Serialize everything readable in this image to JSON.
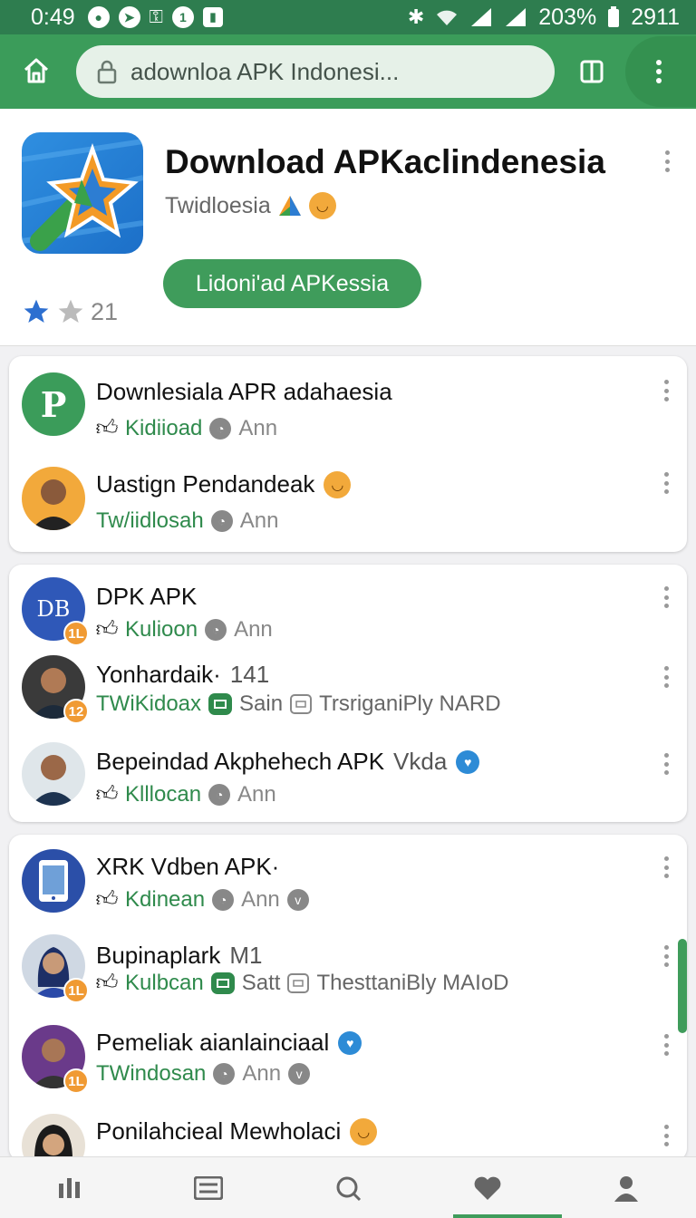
{
  "status_bar": {
    "time": "0:49",
    "battery": "203%",
    "clock_right": "2911"
  },
  "toolbar": {
    "url_text": "adownloa APK Indonesi..."
  },
  "app": {
    "title": "Download APKaclindenesia",
    "developer": "Twidloesia",
    "download_label": "Lidoni'ad APKessia",
    "rating": "21"
  },
  "groups": [
    {
      "items": [
        {
          "title": "Downlesiala APR adahaesia",
          "suffix": "",
          "avatar_text": "P",
          "badge": "",
          "meta1": "Kidiioad",
          "meta2": "Ann",
          "extra": ""
        },
        {
          "title": "Uastign Pendandeak",
          "suffix": "",
          "avatar_text": "",
          "badge": "",
          "meta1": "Tw/iidlosah",
          "meta2": "Ann",
          "extra": ""
        }
      ]
    },
    {
      "items": [
        {
          "title": "DPK APK",
          "suffix": "",
          "avatar_text": "DB",
          "badge": "1L",
          "meta1": "Kulioon",
          "meta2": "Ann",
          "extra": ""
        },
        {
          "title": "Yonhardaik·",
          "suffix": "141",
          "avatar_text": "",
          "badge": "12",
          "meta1": "TWiKidoax",
          "meta2": "Sain",
          "extra": "TrsriganiPly NARD"
        },
        {
          "title": "Bepeindad Akphehech APK",
          "suffix": "Vkda",
          "avatar_text": "",
          "badge": "",
          "meta1": "Klllocan",
          "meta2": "Ann",
          "extra": ""
        }
      ]
    },
    {
      "items": [
        {
          "title": "XRK Vdben APK·",
          "suffix": "",
          "avatar_text": "",
          "badge": "",
          "meta1": "Kdinean",
          "meta2": "Ann",
          "extra": ""
        },
        {
          "title": "Bupinaplark",
          "suffix": "M1",
          "avatar_text": "",
          "badge": "1L",
          "meta1": "Kulbcan",
          "meta2": "Satt",
          "extra": "ThesttaniBly MAIoD"
        },
        {
          "title": "Pemeliak aianlainciaal",
          "suffix": "",
          "avatar_text": "",
          "badge": "1L",
          "meta1": "TWindosan",
          "meta2": "Ann",
          "extra": ""
        },
        {
          "title": "Ponilahcieal Mewholaci",
          "suffix": "",
          "avatar_text": "",
          "badge": "",
          "meta1": "",
          "meta2": "",
          "extra": ""
        }
      ]
    }
  ],
  "icons": {
    "accent": "#3f9c5b",
    "statusbar_color": "#2e7d4f",
    "bottom_nav": [
      "stats-icon",
      "list-icon",
      "search-icon",
      "heart-icon",
      "profile-icon"
    ]
  }
}
